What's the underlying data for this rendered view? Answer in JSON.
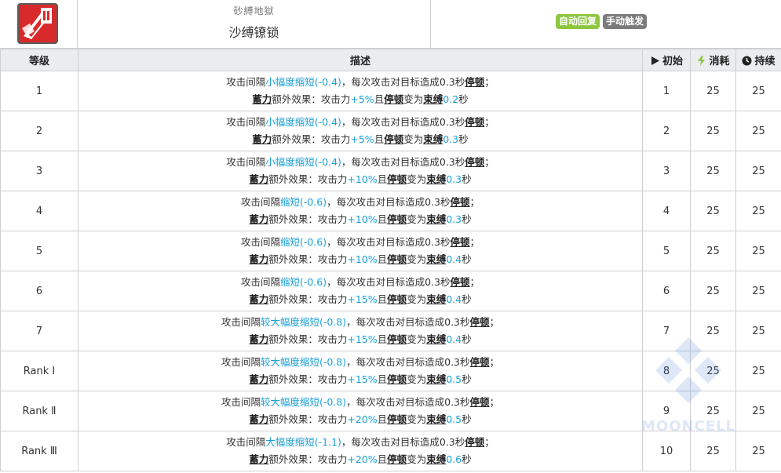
{
  "header": {
    "subtitle": "砂縛地獄",
    "skill_name": "沙缚镣锁",
    "tags": [
      {
        "label": "自动回复",
        "color": "#8ec63f"
      },
      {
        "label": "手动触发",
        "color": "#7b7b7b"
      }
    ]
  },
  "columns": {
    "level": "等级",
    "desc": "描述",
    "init": "初始",
    "cost": "消耗",
    "duration": "持续"
  },
  "colors": {
    "accent": "#1aa0d8",
    "header_bg": "#eaecf0",
    "border": "#cfcfcf"
  },
  "watermark": "MOONCELL",
  "rows": [
    {
      "level": "1",
      "p1": "攻击间隔",
      "b1": "小幅度缩短(-0.4)",
      "p2": "，每次攻击对目标造成0.3秒",
      "kw1": "停顿",
      "p3": "；",
      "kw2": "蓄力",
      "p4": "额外效果：攻击力",
      "b2": "+5%",
      "p5": "且",
      "kw3": "停顿",
      "p6": "变为",
      "kw4": "束缚",
      "b3": "0.2",
      "p7": "秒",
      "init": "1",
      "cost": "25",
      "duration": "25"
    },
    {
      "level": "2",
      "p1": "攻击间隔",
      "b1": "小幅度缩短(-0.4)",
      "p2": "，每次攻击对目标造成0.3秒",
      "kw1": "停顿",
      "p3": "；",
      "kw2": "蓄力",
      "p4": "额外效果：攻击力",
      "b2": "+5%",
      "p5": "且",
      "kw3": "停顿",
      "p6": "变为",
      "kw4": "束缚",
      "b3": "0.3",
      "p7": "秒",
      "init": "2",
      "cost": "25",
      "duration": "25"
    },
    {
      "level": "3",
      "p1": "攻击间隔",
      "b1": "小幅度缩短(-0.4)",
      "p2": "，每次攻击对目标造成0.3秒",
      "kw1": "停顿",
      "p3": "；",
      "kw2": "蓄力",
      "p4": "额外效果：攻击力",
      "b2": "+10%",
      "p5": "且",
      "kw3": "停顿",
      "p6": "变为",
      "kw4": "束缚",
      "b3": "0.3",
      "p7": "秒",
      "init": "3",
      "cost": "25",
      "duration": "25"
    },
    {
      "level": "4",
      "p1": "攻击间隔",
      "b1": "缩短(-0.6)",
      "p2": "，每次攻击对目标造成0.3秒",
      "kw1": "停顿",
      "p3": "；",
      "kw2": "蓄力",
      "p4": "额外效果：攻击力",
      "b2": "+10%",
      "p5": "且",
      "kw3": "停顿",
      "p6": "变为",
      "kw4": "束缚",
      "b3": "0.3",
      "p7": "秒",
      "init": "4",
      "cost": "25",
      "duration": "25"
    },
    {
      "level": "5",
      "p1": "攻击间隔",
      "b1": "缩短(-0.6)",
      "p2": "，每次攻击对目标造成0.3秒",
      "kw1": "停顿",
      "p3": "；",
      "kw2": "蓄力",
      "p4": "额外效果：攻击力",
      "b2": "+10%",
      "p5": "且",
      "kw3": "停顿",
      "p6": "变为",
      "kw4": "束缚",
      "b3": "0.4",
      "p7": "秒",
      "init": "5",
      "cost": "25",
      "duration": "25"
    },
    {
      "level": "6",
      "p1": "攻击间隔",
      "b1": "缩短(-0.6)",
      "p2": "，每次攻击对目标造成0.3秒",
      "kw1": "停顿",
      "p3": "；",
      "kw2": "蓄力",
      "p4": "额外效果：攻击力",
      "b2": "+15%",
      "p5": "且",
      "kw3": "停顿",
      "p6": "变为",
      "kw4": "束缚",
      "b3": "0.4",
      "p7": "秒",
      "init": "6",
      "cost": "25",
      "duration": "25"
    },
    {
      "level": "7",
      "p1": "攻击间隔",
      "b1": "较大幅度缩短(-0.8)",
      "p2": "，每次攻击对目标造成0.3秒",
      "kw1": "停顿",
      "p3": "；",
      "kw2": "蓄力",
      "p4": "额外效果：攻击力",
      "b2": "+15%",
      "p5": "且",
      "kw3": "停顿",
      "p6": "变为",
      "kw4": "束缚",
      "b3": "0.4",
      "p7": "秒",
      "init": "7",
      "cost": "25",
      "duration": "25"
    },
    {
      "level": "Rank Ⅰ",
      "p1": "攻击间隔",
      "b1": "较大幅度缩短(-0.8)",
      "p2": "，每次攻击对目标造成0.3秒",
      "kw1": "停顿",
      "p3": "；",
      "kw2": "蓄力",
      "p4": "额外效果：攻击力",
      "b2": "+15%",
      "p5": "且",
      "kw3": "停顿",
      "p6": "变为",
      "kw4": "束缚",
      "b3": "0.5",
      "p7": "秒",
      "init": "8",
      "cost": "25",
      "duration": "25"
    },
    {
      "level": "Rank Ⅱ",
      "p1": "攻击间隔",
      "b1": "较大幅度缩短(-0.8)",
      "p2": "，每次攻击对目标造成0.3秒",
      "kw1": "停顿",
      "p3": "；",
      "kw2": "蓄力",
      "p4": "额外效果：攻击力",
      "b2": "+20%",
      "p5": "且",
      "kw3": "停顿",
      "p6": "变为",
      "kw4": "束缚",
      "b3": "0.5",
      "p7": "秒",
      "init": "9",
      "cost": "25",
      "duration": "25"
    },
    {
      "level": "Rank Ⅲ",
      "p1": "攻击间隔",
      "b1": "大幅度缩短(-1.1)",
      "p2": "，每次攻击对目标造成0.3秒",
      "kw1": "停顿",
      "p3": "；",
      "kw2": "蓄力",
      "p4": "额外效果：攻击力",
      "b2": "+20%",
      "p5": "且",
      "kw3": "停顿",
      "p6": "变为",
      "kw4": "束缚",
      "b3": "0.6",
      "p7": "秒",
      "init": "10",
      "cost": "25",
      "duration": "25"
    }
  ]
}
